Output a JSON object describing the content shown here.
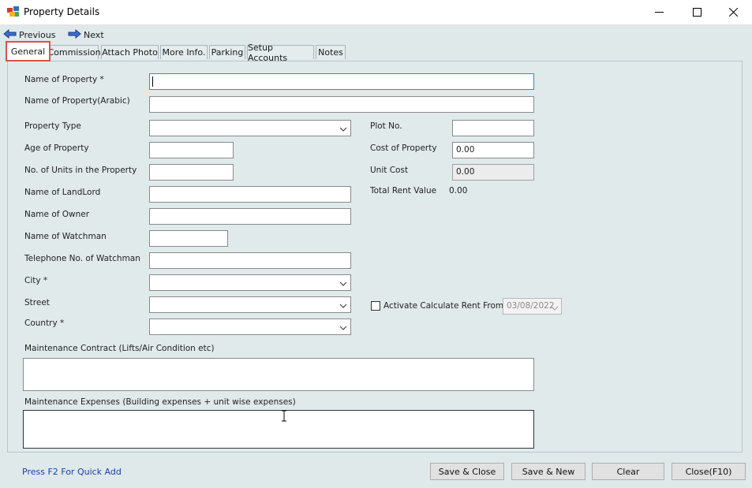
{
  "window": {
    "title": "Property Details"
  },
  "nav": {
    "previous": "Previous",
    "next": "Next"
  },
  "tabs": [
    "General",
    "Commission",
    "Attach Photo",
    "More Info.",
    "Parking",
    "Setup Accounts",
    "Notes"
  ],
  "form": {
    "name_of_property": "Name of Property *",
    "name_of_property_arabic": "Name of Property(Arabic)",
    "property_type": "Property Type",
    "age_of_property": "Age of Property",
    "no_of_units": "No. of Units in the Property",
    "name_of_landlord": "Name of LandLord",
    "name_of_owner": "Name of Owner",
    "name_of_watchman": "Name of Watchman",
    "telephone_watchman": "Telephone No. of Watchman",
    "city": "City *",
    "street": "Street",
    "country": "Country *",
    "plot_no": "Plot No.",
    "cost_of_property": "Cost of Property",
    "cost_of_property_value": "0.00",
    "unit_cost": "Unit Cost",
    "unit_cost_value": "0.00",
    "total_rent_value": "Total Rent Value",
    "total_rent_value_amount": "0.00",
    "activate_calc_rent": "Activate Calculate Rent From",
    "activate_date": "03/08/2022",
    "maintenance_contract": "Maintenance Contract (Lifts/Air Condition etc)",
    "maintenance_expenses": "Maintenance Expenses (Building expenses + unit wise expenses)"
  },
  "footer": {
    "quick_add": "Press F2 For Quick Add",
    "save_close": "Save & Close",
    "save_new": "Save & New",
    "clear": "Clear",
    "close": "Close(F10)"
  },
  "colors": {
    "active_tab_highlight": "#e05045",
    "panel_bg": "#e0eaeb",
    "link": "#1a3fb0"
  }
}
